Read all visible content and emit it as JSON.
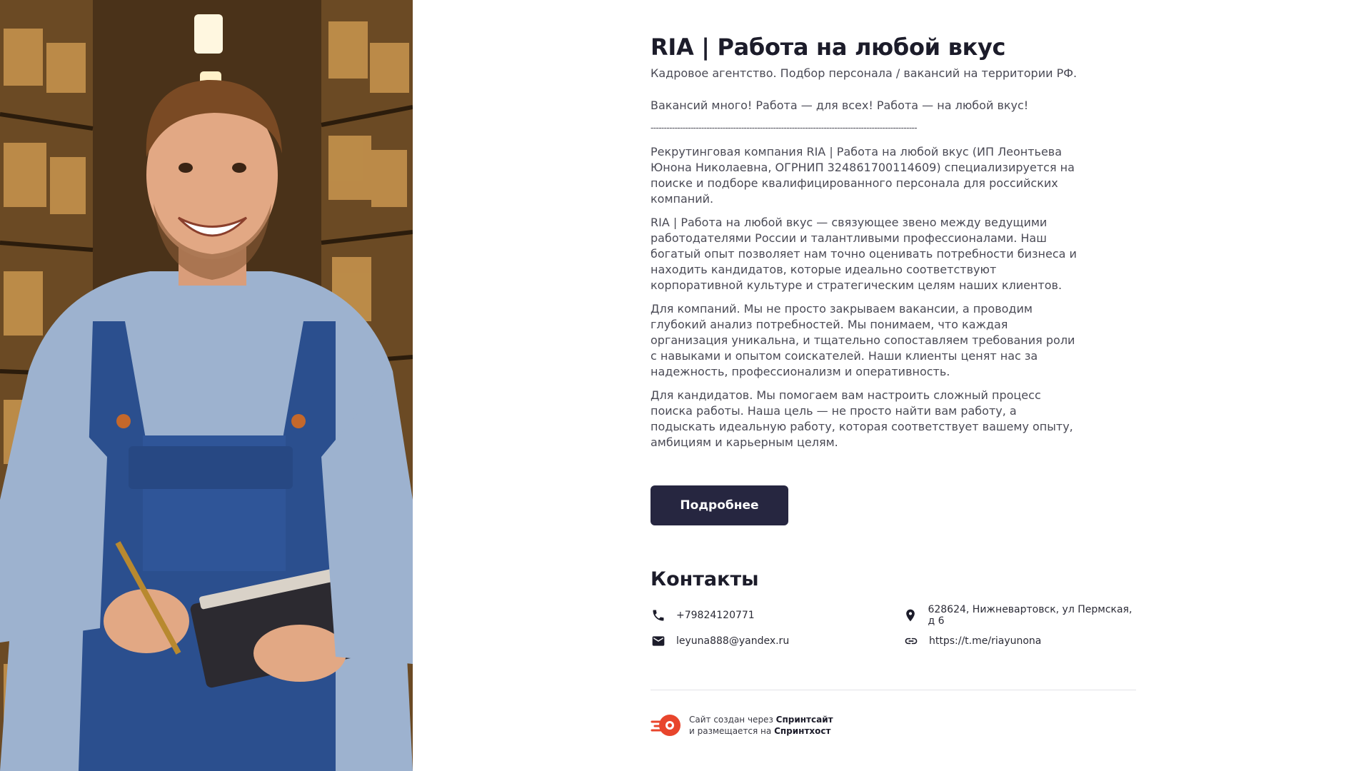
{
  "hero": {
    "image_alt": "Smiling warehouse worker in denim overalls holding a clipboard and pen"
  },
  "main": {
    "title": "RIA | Работа на любой вкус",
    "subtitle": "Кадровое агентство. Подбор персонала / вакансий на территории РФ.",
    "tagline": "Вакансий много! Работа — для всех! Работа — на любой вкус!",
    "divider": "----------------------------------------------------------------------------------------------------",
    "paragraphs": [
      "Рекрутинговая компания RIA | Работа на любой вкус (ИП Леонтьева Юнона Николаевна, ОГРНИП 324861700114609) специализируется на поиске и подборе квалифицированного персонала для российских компаний.",
      "RIA | Работа на любой вкус — связующее звено между ведущими работодателями России и талантливыми профессионалами. Наш богатый опыт позволяет нам точно оценивать потребности бизнеса и находить кандидатов, которые идеально соответствуют корпоративной культуре и стратегическим целям наших клиентов.",
      "Для компаний. Мы не просто закрываем вакансии, а проводим глубокий анализ потребностей. Мы понимаем, что каждая организация уникальна, и тщательно сопоставляем требования роли с навыками и опытом соискателей. Наши клиенты ценят нас за надежность, профессионализм и оперативность.",
      "Для кандидатов. Мы помогаем вам настроить сложный процесс поиска работы. Наша цель — не просто найти вам работу, а подыскать идеальную работу, которая соответствует вашему опыту, амбициям и карьерным целям."
    ],
    "more_button": "Подробнее"
  },
  "contacts": {
    "title": "Контакты",
    "phone": "+79824120771",
    "address": "628624, Нижневартовск, ул Пермская, д 6",
    "email": "leyuna888@yandex.ru",
    "link": "https://t.me/riayunona"
  },
  "footer": {
    "line1_prefix": "Сайт создан через ",
    "line1_brand": "Спринтсайт",
    "line2_prefix": "и размещается на ",
    "line2_brand": "Спринтхост"
  },
  "colors": {
    "button_bg": "#262640",
    "title": "#1c1c2a",
    "body_text": "#4a4a55",
    "footer_logo": "#e8452c"
  },
  "icons": [
    "phone-icon",
    "location-pin-icon",
    "mail-icon",
    "link-icon",
    "sprinthost-logo-icon"
  ]
}
